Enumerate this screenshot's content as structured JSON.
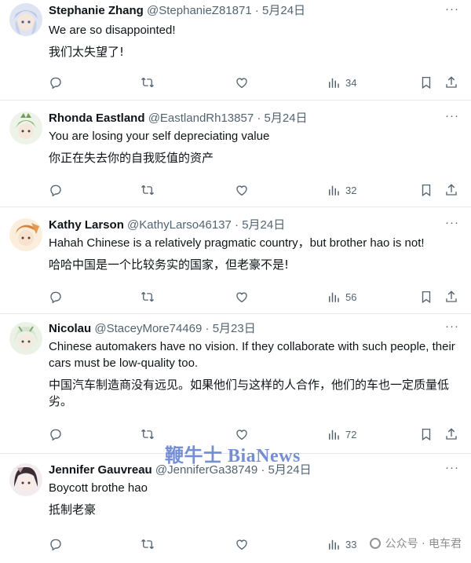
{
  "tweets": [
    {
      "name": "Stephanie Zhang",
      "handle": "@StephanieZ81871",
      "date": "5月24日",
      "text": "We are so disappointed!",
      "translation": "我们太失望了!",
      "views": "34",
      "avatar_color": "#c9d3ea"
    },
    {
      "name": "Rhonda Eastland",
      "handle": "@EastlandRh13857",
      "date": "5月24日",
      "text": "You are losing your self depreciating value",
      "translation": "你正在失去你的自我贬值的资产",
      "views": "32",
      "avatar_color": "#b8d4a8"
    },
    {
      "name": "Kathy Larson",
      "handle": "@KathyLarso46137",
      "date": "5月24日",
      "text": "Hahah Chinese is a relatively pragmatic country，but brother hao is not!",
      "translation": "哈哈中国是一个比较务实的国家，但老豪不是!",
      "views": "56",
      "avatar_color": "#e0a070"
    },
    {
      "name": "Nicolau",
      "handle": "@StaceyMore74469",
      "date": "5月23日",
      "text": "Chinese automakers have no vision. If they collaborate with such people, their cars must be low-quality too.",
      "translation": "中国汽车制造商没有远见。如果他们与这样的人合作，他们的车也一定质量低劣。",
      "views": "72",
      "avatar_color": "#c8dcc0"
    },
    {
      "name": "Jennifer Gauvreau",
      "handle": "@JenniferGa38749",
      "date": "5月24日",
      "text": "Boycott brothe hao",
      "translation": "抵制老豪",
      "views": "33",
      "avatar_color": "#d9c8cc"
    }
  ],
  "separator": " · ",
  "more_label": "···",
  "watermark": "鞭牛士 BiaNews",
  "watermark2": "公众号 · 电车君"
}
